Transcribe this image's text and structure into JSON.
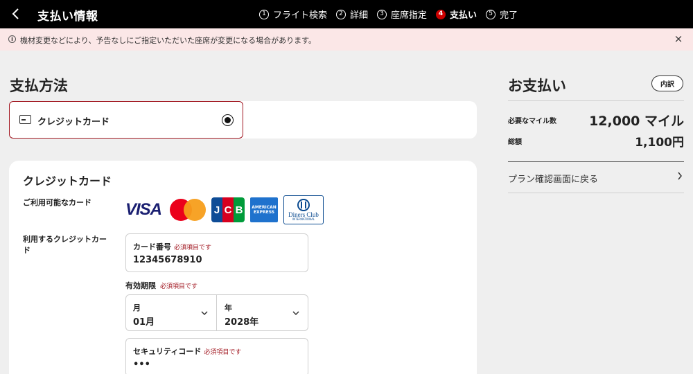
{
  "header": {
    "title": "支払い情報",
    "steps": [
      {
        "num": "1",
        "label": "フライト検索"
      },
      {
        "num": "2",
        "label": "詳細"
      },
      {
        "num": "3",
        "label": "座席指定"
      },
      {
        "num": "4",
        "label": "支払い"
      },
      {
        "num": "5",
        "label": "完了"
      }
    ],
    "active_step": 4
  },
  "notice": {
    "icon": "info-icon",
    "text": "機材変更などにより、予告なしにご指定いただいた座席が変更になる場合があります。",
    "close": "×"
  },
  "payment_method": {
    "title": "支払方法",
    "option_label": "クレジットカード",
    "selected": true
  },
  "card_panel": {
    "title": "クレジットカード",
    "available_label": "ご利用可能なカード",
    "brands": {
      "visa": "VISA",
      "jcb": [
        "J",
        "C",
        "B"
      ],
      "amex": [
        "AMERICAN",
        "EXPRESS"
      ],
      "diners": [
        "Diners Club",
        "INTERNATIONAL"
      ]
    },
    "use_label": "利用するクレジットカード",
    "card_number": {
      "label": "カード番号",
      "required": "必須項目です",
      "value": "12345678910"
    },
    "expiry": {
      "label": "有効期限",
      "required": "必須項目です"
    },
    "month": {
      "label": "月",
      "value": "01月"
    },
    "year": {
      "label": "年",
      "value": "2028年"
    },
    "security_code": {
      "label": "セキュリティコード",
      "required": "必須項目です",
      "value": "•••"
    }
  },
  "summary": {
    "title": "お支払い",
    "detail_button": "内訳",
    "miles_label": "必要なマイル数",
    "miles_value": "12,000 マイル",
    "total_label": "総額",
    "total_value": "1,100円",
    "back_link": "プラン確認画面に戻る"
  },
  "colors": {
    "header_bg": "#000000",
    "notice_bg": "#fbe7e7",
    "accent_red": "#a0141e",
    "active_step": "#cc0000"
  }
}
